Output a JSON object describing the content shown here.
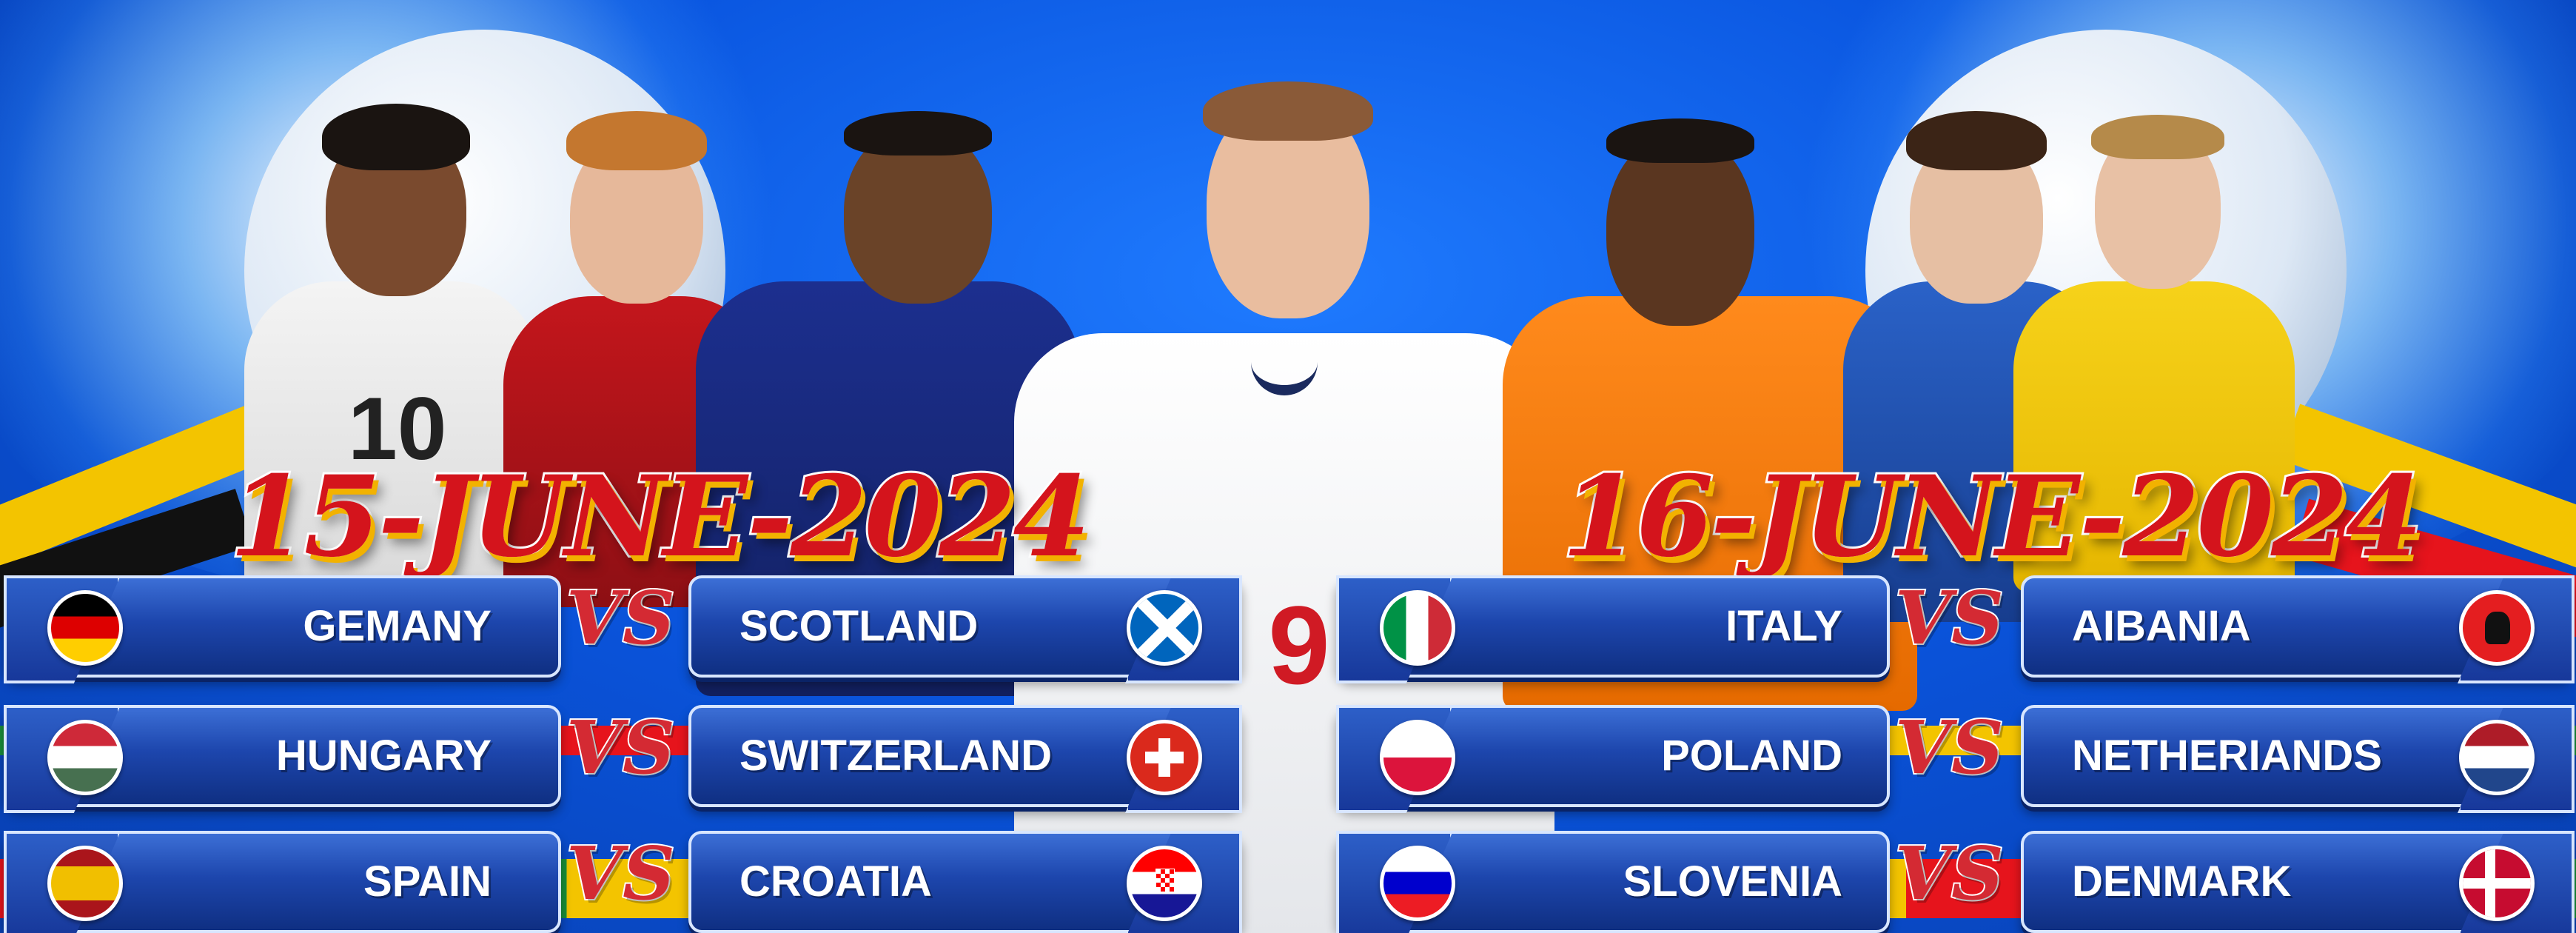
{
  "dates": {
    "left": "15-JUNE-2024",
    "right": "16-JUNE-2024"
  },
  "vs_label": "VS",
  "shirt_number": "9",
  "players": {
    "germany_number": "10"
  },
  "matches_left": [
    {
      "home": "GEMANY",
      "away": "SCOTLAND"
    },
    {
      "home": "HUNGARY",
      "away": "SWITZERLAND"
    },
    {
      "home": "SPAIN",
      "away": "CROATIA"
    }
  ],
  "matches_right": [
    {
      "home": "ITALY",
      "away": "AIBANIA"
    },
    {
      "home": "POLAND",
      "away": "NETHERIANDS"
    },
    {
      "home": "SLOVENIA",
      "away": "DENMARK"
    }
  ],
  "colors": {
    "background": "#0a56e0",
    "date_text": "#d4141c",
    "pill": "#1d46ad",
    "vs": "#d42a33"
  }
}
